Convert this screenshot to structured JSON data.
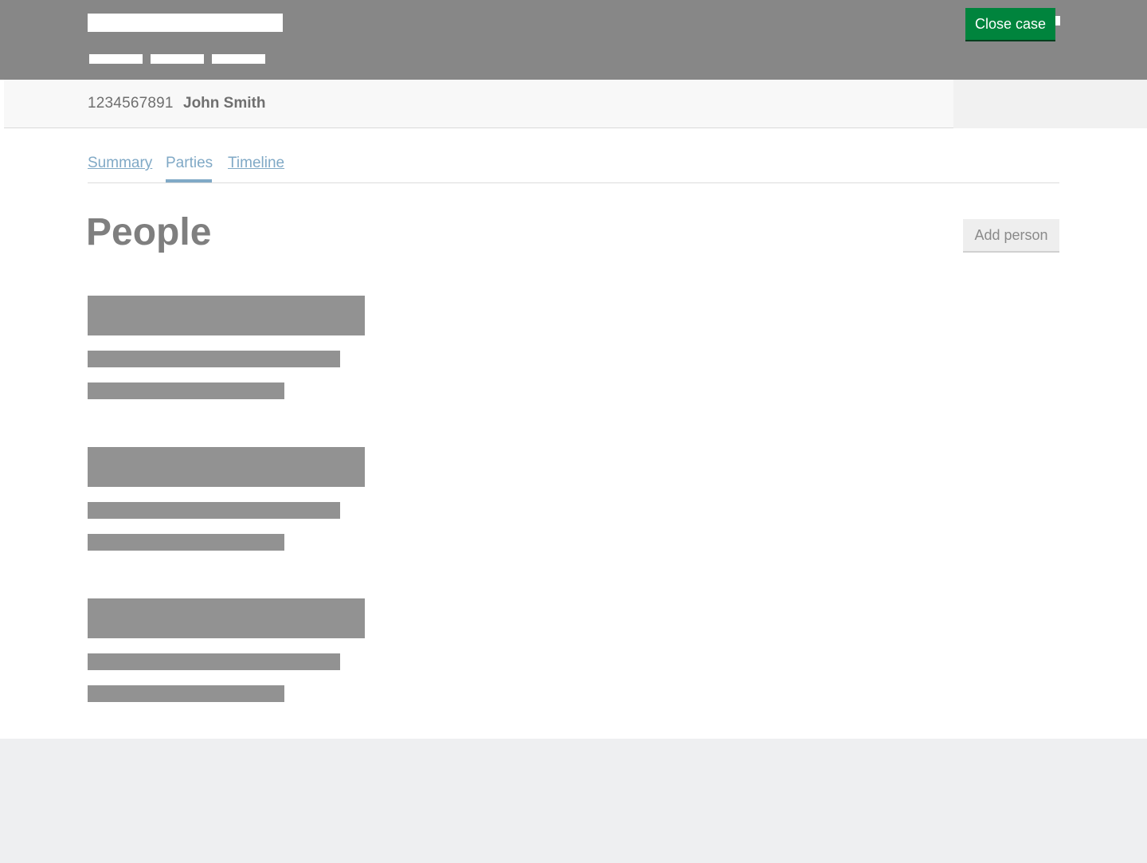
{
  "case": {
    "number": "1234567891",
    "name": "John Smith",
    "close_label": "Close case"
  },
  "tabs": [
    {
      "label": "Summary",
      "active": false
    },
    {
      "label": "Parties",
      "active": true
    },
    {
      "label": "Timeline",
      "active": false
    }
  ],
  "main": {
    "title": "People",
    "add_label": "Add person"
  },
  "colors": {
    "header": "#878787",
    "primary_button": "#00843d",
    "link": "#80a9c6",
    "skeleton": "#929292",
    "footer": "#eeeff1"
  }
}
